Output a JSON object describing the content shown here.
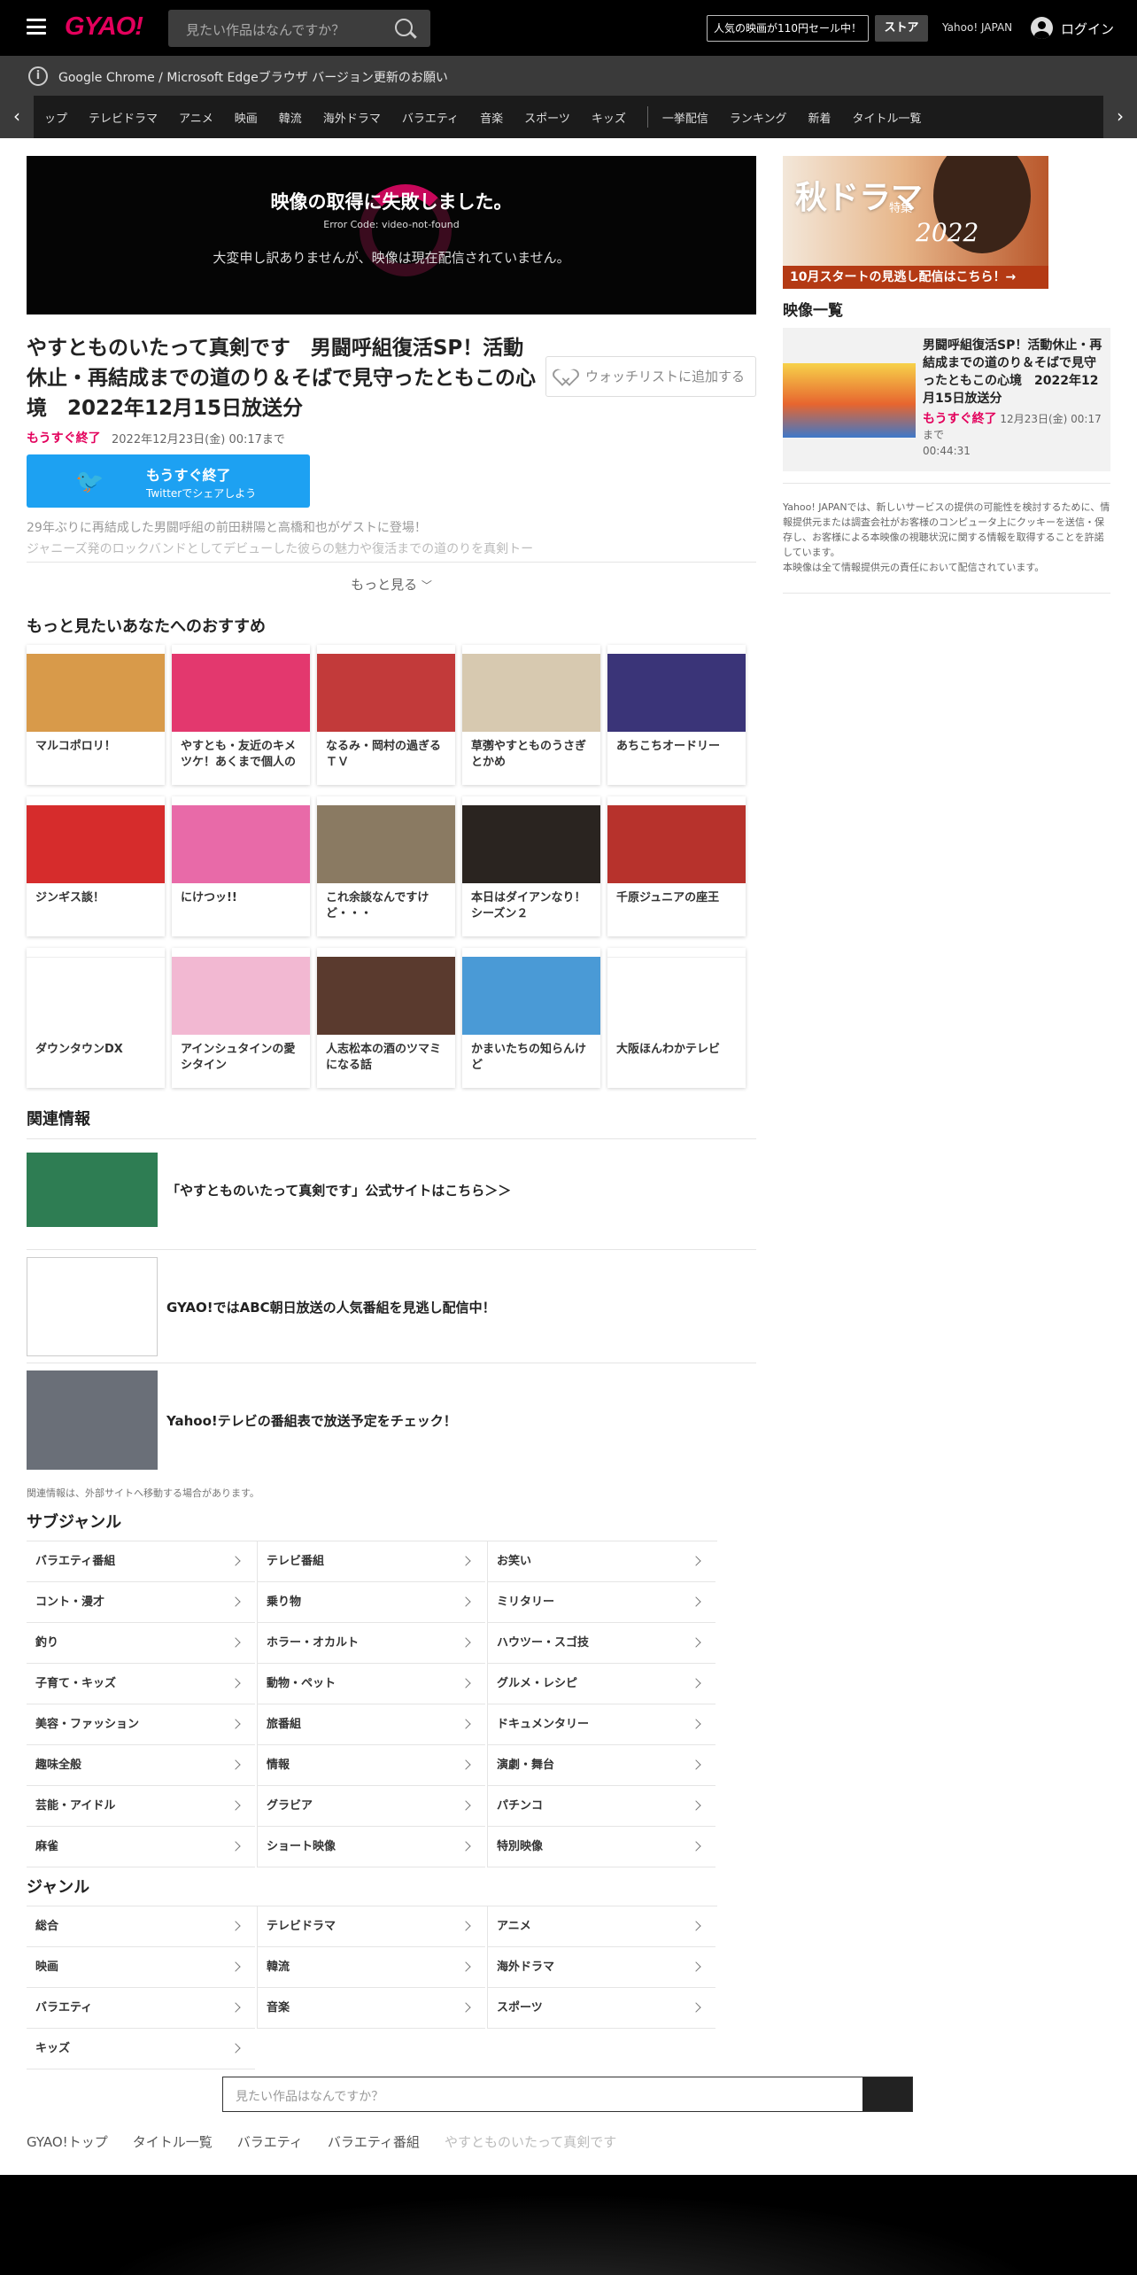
{
  "header": {
    "logo": "GYAO!",
    "search_placeholder": "見たい作品はなんですか？",
    "sale_label": "人気の映画が110円セール中！",
    "store_label": "ストア",
    "yahoo_label": "Yahoo! JAPAN",
    "login_label": "ログイン"
  },
  "notice": {
    "text": "Google Chrome / Microsoft Edgeブラウザ バージョン更新のお願い"
  },
  "nav": {
    "items": [
      "ップ",
      "テレビドラマ",
      "アニメ",
      "映画",
      "韓流",
      "海外ドラマ",
      "バラエティ",
      "音楽",
      "スポーツ",
      "キッズ"
    ],
    "items2": [
      "一挙配信",
      "ランキング",
      "新着",
      "タイトル一覧"
    ]
  },
  "player": {
    "error_title": "映像の取得に失敗しました。",
    "error_code": "Error Code: video-not-found",
    "error_message": "大変申し訳ありませんが、映像は現在配信されていません。"
  },
  "episode": {
    "title": "やすとものいたって真剣です　男闘呼組復活SP！活動休止・再結成までの道のり＆そばで見守ったともこの心境　2022年12月15日放送分",
    "watchlist_label": "ウォッチリストに追加する",
    "status": "もうすぐ終了",
    "until": "2022年12月23日(金) 00:17まで",
    "twitter_line1": "もうすぐ終了",
    "twitter_line2": "Twitterでシェアしよう",
    "desc1": "29年ぶりに再結成した男闘呼組の前田耕陽と高橋和也がゲストに登場！",
    "desc2": "ジャニーズ発のロックバンドとしてデビューした彼らの魅力や復活までの道のりを真剣トー",
    "more_label": "もっと見る"
  },
  "recommend": {
    "heading": "もっと見たいあなたへのおすすめ",
    "items": [
      {
        "title": "マルコポロリ！",
        "color": "#d89a4a"
      },
      {
        "title": "やすとも・友近のキメツケ！あくまで個人の",
        "color": "#e3386e"
      },
      {
        "title": "なるみ・岡村の過ぎるＴＶ",
        "color": "#c23a3a"
      },
      {
        "title": "草彅やすとものうさぎとかめ",
        "color": "#d7c9b0"
      },
      {
        "title": "あちこちオードリー",
        "color": "#3a3478"
      },
      {
        "title": "ジンギス談！",
        "color": "#d62c2c"
      },
      {
        "title": "にけつッ!!",
        "color": "#e86aa8"
      },
      {
        "title": "これ余談なんですけど・・・",
        "color": "#8a7a62"
      },
      {
        "title": "本日はダイアンなり！シーズン２",
        "color": "#2a2420"
      },
      {
        "title": "千原ジュニアの座王",
        "color": "#b7322c"
      },
      {
        "title": "ダウンタウンDX",
        "color": "#ffffff"
      },
      {
        "title": "アインシュタインの愛シタイン",
        "color": "#f2b8d2"
      },
      {
        "title": "人志松本の酒のツマミになる話",
        "color": "#5a3a2e"
      },
      {
        "title": "かまいたちの知らんけど",
        "color": "#4a9ad6"
      },
      {
        "title": "大阪ほんわかテレビ",
        "color": "#ffffff"
      }
    ]
  },
  "related": {
    "heading": "関連情報",
    "items": [
      {
        "text": "「やすとものいたって真剣です」公式サイトはこちら＞＞"
      },
      {
        "text": "GYAO!ではABC朝日放送の人気番組を見逃し配信中！"
      },
      {
        "text": "Yahoo!テレビの番組表で放送予定をチェック！"
      }
    ],
    "note": "関連情報は、外部サイトへ移動する場合があります。"
  },
  "subgenre": {
    "heading": "サブジャンル",
    "items": [
      "バラエティ番組",
      "テレビ番組",
      "お笑い",
      "コント・漫才",
      "乗り物",
      "ミリタリー",
      "釣り",
      "ホラー・オカルト",
      "ハウツー・スゴ技",
      "子育て・キッズ",
      "動物・ペット",
      "グルメ・レシピ",
      "美容・ファッション",
      "旅番組",
      "ドキュメンタリー",
      "趣味全般",
      "情報",
      "演劇・舞台",
      "芸能・アイドル",
      "グラビア",
      "パチンコ",
      "麻雀",
      "ショート映像",
      "特別映像"
    ]
  },
  "genre": {
    "heading": "ジャンル",
    "items": [
      "総合",
      "テレビドラマ",
      "アニメ",
      "映画",
      "韓流",
      "海外ドラマ",
      "バラエティ",
      "音楽",
      "スポーツ",
      "キッズ"
    ]
  },
  "footer_search": {
    "placeholder": "見たい作品はなんですか？"
  },
  "breadcrumb": {
    "items": [
      "GYAO!トップ",
      "タイトル一覧",
      "バラエティ",
      "バラエティ番組"
    ],
    "current": "やすとものいたって真剣です"
  },
  "sidebar": {
    "banner_title": "秋ドラマ",
    "banner_sub": "特集",
    "banner_year": "2022",
    "banner_cta": "10月スタートの見逃し配信はこちら！→",
    "list_heading": "映像一覧",
    "item_title": "男闘呼組復活SP！活動休止・再結成までの道のり＆そばで見守ったともこの心境　2022年12月15日放送分",
    "item_status": "もうすぐ終了",
    "item_until": "12月23日(金) 00:17まで",
    "item_duration": "00:44:31",
    "notice": "Yahoo! JAPANでは、新しいサービスの提供の可能性を検討するために、情報提供元または調査会社がお客様のコンピュータ上にクッキーを送信・保存し、お客様による本映像の視聴状況に関する情報を取得することを許諾しています。",
    "notice2": "本映像は全て情報提供元の責任において配信されています。"
  },
  "colors": {
    "brand": "#e3005c",
    "twitter": "#1da1f2"
  }
}
